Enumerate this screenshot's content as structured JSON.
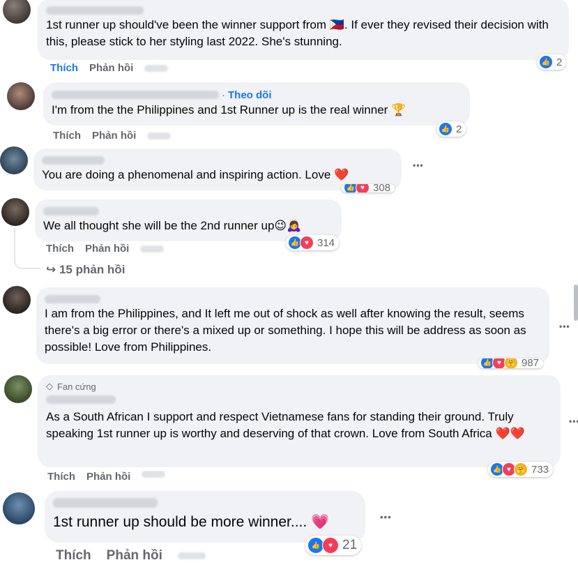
{
  "ui": {
    "like": "Thích",
    "reply": "Phản hồi",
    "follow": "Theo dõi",
    "fan_badge": "Fan cứng",
    "more": "•••"
  },
  "comments": [
    {
      "text": "1st runner up should've been the winner support from 🇵🇭. If ever they revised their decision with this, please stick to her styling last 2022. She's stunning.",
      "reaction_count": "2"
    },
    {
      "text": "I'm from the the Philippines and 1st Runner up is the real winner 🏆",
      "reaction_count": "2"
    },
    {
      "text": "You are doing a phenomenal and inspiring action. Love ❤️",
      "reaction_count": "308"
    },
    {
      "text": "We all thought she will be the 2nd runner up😉🙇‍♀️",
      "reaction_count": "314",
      "replies_label": "15 phản hồi"
    },
    {
      "text": "I am from the Philippines, and It left me out of shock as well after knowing the result, seems there's a big error or there's a mixed up or something. I hope this will be address as soon as possible! Love from Philippines.",
      "reaction_count": "987"
    },
    {
      "text": "As a South African I support and respect Vietnamese fans for standing their ground. Truly speaking 1st runner up is worthy and deserving of that crown. Love from South Africa ❤️❤️",
      "reaction_count": "733"
    },
    {
      "text": "1st runner up should be more winner.... 💗",
      "reaction_count": "21"
    }
  ],
  "colors": {
    "accent": "#1877f2",
    "bubble": "#f0f2f5",
    "secondary_text": "#65676b"
  }
}
